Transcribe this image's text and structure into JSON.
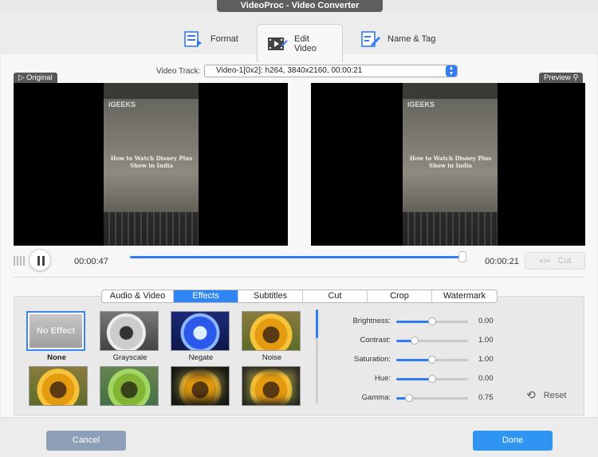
{
  "window": {
    "title": "VideoProc - Video Converter"
  },
  "tabs": [
    {
      "label": "Format",
      "icon": "format-icon"
    },
    {
      "label": "Edit Video",
      "icon": "edit-video-icon"
    },
    {
      "label": "Name & Tag",
      "icon": "name-tag-icon"
    }
  ],
  "video_track": {
    "label": "Video Track:",
    "value": "Video-1[0x2]: h264, 3840x2160, 00:00:21"
  },
  "preview": {
    "original_label": "Original",
    "preview_label": "Preview",
    "site_logo": "iGEEKS",
    "article_title": "How to Watch Disney Plus Show in India"
  },
  "playback": {
    "current_time": "00:00:47",
    "end_time": "00:00:21",
    "progress_fraction": 0.98,
    "cut_label": "Cut"
  },
  "edit_tabs": [
    {
      "label": "Audio & Video",
      "active": false
    },
    {
      "label": "Effects",
      "active": true
    },
    {
      "label": "Subtitles",
      "active": false
    },
    {
      "label": "Cut",
      "active": false
    },
    {
      "label": "Crop",
      "active": false
    },
    {
      "label": "Watermark",
      "active": false
    }
  ],
  "effects": [
    {
      "label": "None",
      "thumb_text": "No Effect",
      "selected": true
    },
    {
      "label": "Grayscale"
    },
    {
      "label": "Negate"
    },
    {
      "label": "Noise"
    }
  ],
  "adjustments": [
    {
      "label": "Brightness:",
      "value": "0.00",
      "fraction": 0.5
    },
    {
      "label": "Contrast:",
      "value": "1.00",
      "fraction": 0.25
    },
    {
      "label": "Saturation:",
      "value": "1.00",
      "fraction": 0.5
    },
    {
      "label": "Hue:",
      "value": "0.00",
      "fraction": 0.5
    },
    {
      "label": "Gamma:",
      "value": "0.75",
      "fraction": 0.18
    }
  ],
  "reset_label": "Reset",
  "footer": {
    "cancel_label": "Cancel",
    "done_label": "Done"
  },
  "colors": {
    "accent": "#2f7df6",
    "cancel_bg": "#8e9fb8",
    "done_bg": "#2f95f3"
  }
}
